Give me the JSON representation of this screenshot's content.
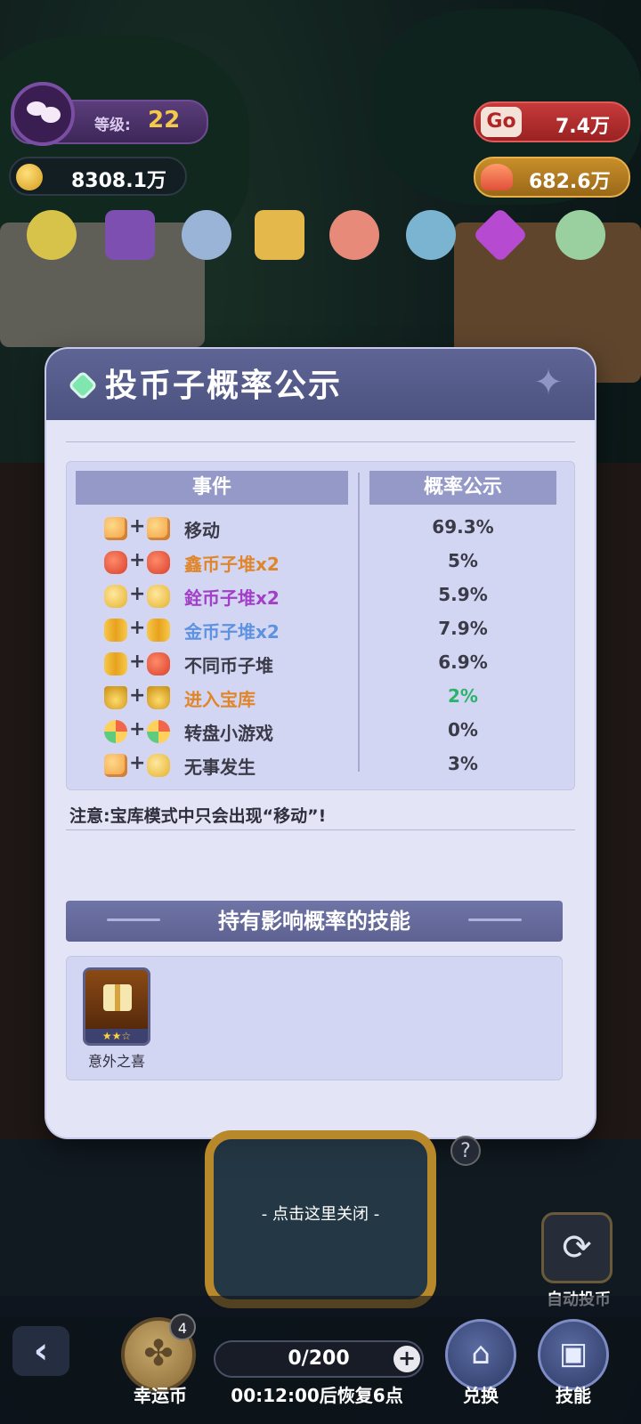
{
  "hud": {
    "level_label": "等级:",
    "level_value": "22",
    "coins": "8308.1万",
    "go_icon": "Go",
    "go_value": "7.4万",
    "gem_value": "682.6万"
  },
  "panel": {
    "title": "投币子概率公示",
    "table": {
      "col_event": "事件",
      "col_prob": "概率公示",
      "rows": [
        {
          "icons": [
            "dice",
            "dice"
          ],
          "label": "移动",
          "prob": "69.3%",
          "label_color": "#3a3a48",
          "prob_color": "#3a3a48"
        },
        {
          "icons": [
            "redbag",
            "redbag"
          ],
          "label": "鑫币子堆x2",
          "prob": "5%",
          "label_color": "#e0862a",
          "prob_color": "#3a3a48"
        },
        {
          "icons": [
            "goldbag",
            "goldbag"
          ],
          "label": "銓币子堆x2",
          "prob": "5.9%",
          "label_color": "#a23ec8",
          "prob_color": "#3a3a48"
        },
        {
          "icons": [
            "coins",
            "coins"
          ],
          "label": "金币子堆x2",
          "prob": "7.9%",
          "label_color": "#5c92e0",
          "prob_color": "#3a3a48"
        },
        {
          "icons": [
            "coins",
            "redbag"
          ],
          "label": "不同币子堆",
          "prob": "6.9%",
          "label_color": "#3a3a48",
          "prob_color": "#3a3a48"
        },
        {
          "icons": [
            "crown",
            "crown"
          ],
          "label": "进入宝库",
          "prob": "2%",
          "label_color": "#e0862a",
          "prob_color": "#2ab46a"
        },
        {
          "icons": [
            "wheel",
            "wheel"
          ],
          "label": "转盘小游戏",
          "prob": "0%",
          "label_color": "#3a3a48",
          "prob_color": "#3a3a48"
        },
        {
          "icons": [
            "dice",
            "goldbag"
          ],
          "label": "无事发生",
          "prob": "3%",
          "label_color": "#3a3a48",
          "prob_color": "#3a3a48"
        }
      ]
    },
    "note": "注意:宝库模式中只会出现“移动”!",
    "skills_title": "持有影响概率的技能",
    "skills": [
      {
        "name": "意外之喜",
        "stars_filled": 2,
        "stars_total": 3
      }
    ]
  },
  "bottom": {
    "close_hint": "- 点击这里关闭 -",
    "auto_label": "自动投币",
    "lucky_badge": "4",
    "lucky_label": "幸运币",
    "energy": "0/200",
    "timer": "00:12:00后恢复6点",
    "exchange_label": "兑换",
    "skill_label": "技能"
  }
}
